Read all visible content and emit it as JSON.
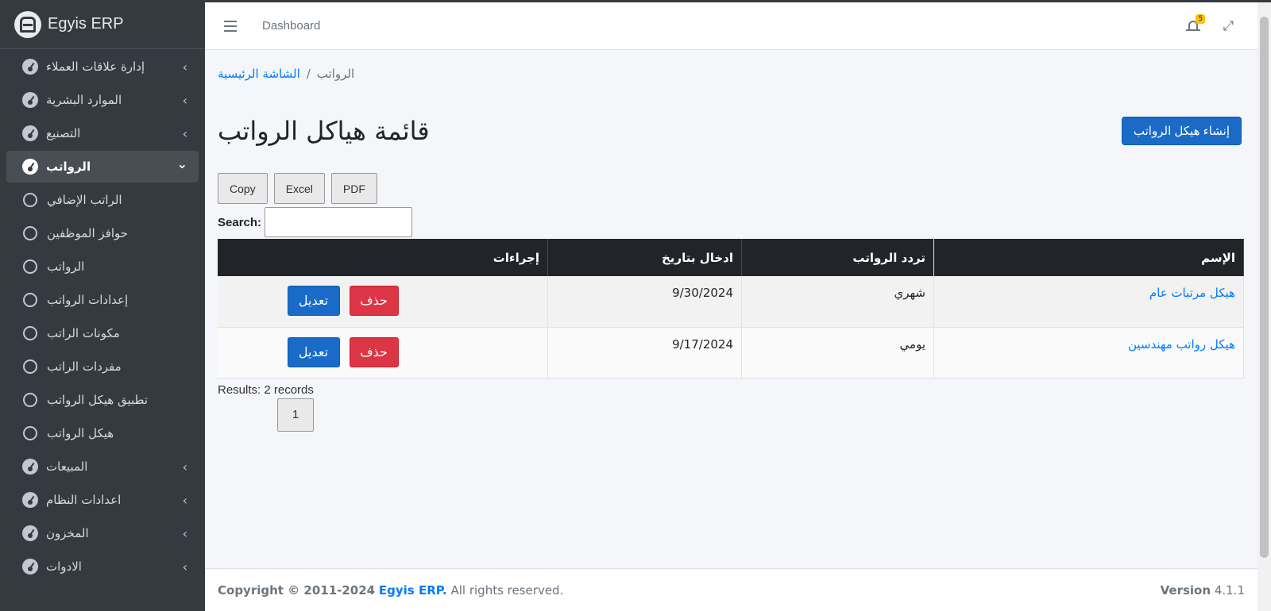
{
  "brand": {
    "name": "Egyis ERP"
  },
  "sidebar": {
    "items": [
      {
        "label": "إدارة علاقات العملاء",
        "type": "group",
        "active": false
      },
      {
        "label": "الموارد البشرية",
        "type": "group",
        "active": false
      },
      {
        "label": "التصنيع",
        "type": "group",
        "active": false
      },
      {
        "label": "الرواتب",
        "type": "group",
        "active": true
      },
      {
        "label": "الراتب الإضافي",
        "type": "sub"
      },
      {
        "label": "حوافز الموظفين",
        "type": "sub"
      },
      {
        "label": "الرواتب",
        "type": "sub"
      },
      {
        "label": "إعدادات الرواتب",
        "type": "sub"
      },
      {
        "label": "مكونات الراتب",
        "type": "sub"
      },
      {
        "label": "مفردات الراتب",
        "type": "sub"
      },
      {
        "label": "تطبيق هيكل الرواتب",
        "type": "sub"
      },
      {
        "label": "هيكل الرواتب",
        "type": "sub"
      },
      {
        "label": "المبيعات",
        "type": "group",
        "active": false
      },
      {
        "label": "اعدادات النظام",
        "type": "group",
        "active": false
      },
      {
        "label": "المخزون",
        "type": "group",
        "active": false
      },
      {
        "label": "الادوات",
        "type": "group",
        "active": false
      }
    ]
  },
  "navbar": {
    "dashboard": "Dashboard",
    "notifications_count": "5"
  },
  "breadcrumb": {
    "home": "الشاشة الرئيسية",
    "separator": "/",
    "current": "الرواتب"
  },
  "page": {
    "title": "قائمة هياكل الرواتب",
    "create_button": "إنشاء هيكل الرواتب"
  },
  "export": {
    "copy": "Copy",
    "excel": "Excel",
    "pdf": "PDF"
  },
  "search": {
    "label": "Search:",
    "value": ""
  },
  "table": {
    "headers": {
      "name": "الإسم",
      "frequency": "تردد الرواتب",
      "date": "ادخال بتاريخ",
      "actions": "إجراءات"
    },
    "rows": [
      {
        "name": "هيكل مرتبات عام",
        "frequency": "شهري",
        "date": "9/30/2024",
        "edit": "تعديل",
        "delete": "حذف"
      },
      {
        "name": "هيكل رواتب مهندسين",
        "frequency": "يومي",
        "date": "9/17/2024",
        "edit": "تعديل",
        "delete": "حذف"
      }
    ]
  },
  "results": "Results: 2 records",
  "pagination": {
    "page": "1"
  },
  "footer": {
    "copyright_prefix": "Copyright © 2011-2024",
    "brand": "Egyis ERP.",
    "rights": "All rights reserved.",
    "version_label": "Version",
    "version": "4.1.1"
  },
  "colors": {
    "sidebar": "#343a40",
    "primary": "#1a6bc7",
    "danger": "#dc3545",
    "link": "#007bff"
  }
}
